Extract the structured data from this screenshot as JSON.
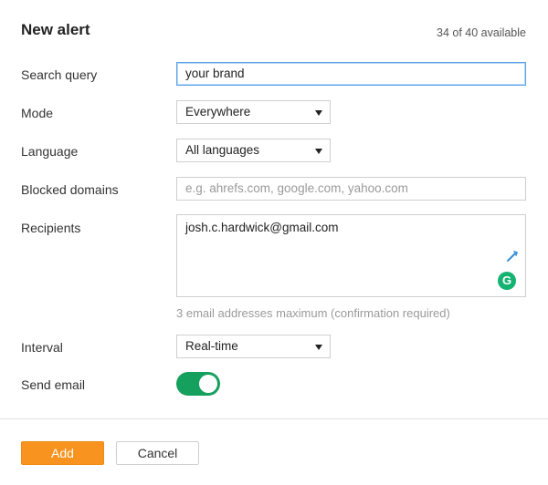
{
  "header": {
    "title": "New alert",
    "quota": "34 of 40 available"
  },
  "form": {
    "search_query": {
      "label": "Search query",
      "value": "your brand"
    },
    "mode": {
      "label": "Mode",
      "selected": "Everywhere"
    },
    "language": {
      "label": "Language",
      "selected": "All languages"
    },
    "blocked_domains": {
      "label": "Blocked domains",
      "placeholder": "e.g. ahrefs.com, google.com, yahoo.com"
    },
    "recipients": {
      "label": "Recipients",
      "value": "josh.c.hardwick@gmail.com",
      "hint": "3 email addresses maximum (confirmation required)"
    },
    "interval": {
      "label": "Interval",
      "selected": "Real-time"
    },
    "send_email": {
      "label": "Send email",
      "enabled": true
    }
  },
  "footer": {
    "add_label": "Add",
    "cancel_label": "Cancel"
  },
  "colors": {
    "accent_orange": "#f7931e",
    "toggle_green": "#16a05d",
    "focus_blue": "#5aa3e8",
    "grammarly_green": "#15b371"
  },
  "icons": {
    "select_caret": "caret-down-icon",
    "resize": "pen-icon",
    "grammarly": "grammarly-icon"
  }
}
